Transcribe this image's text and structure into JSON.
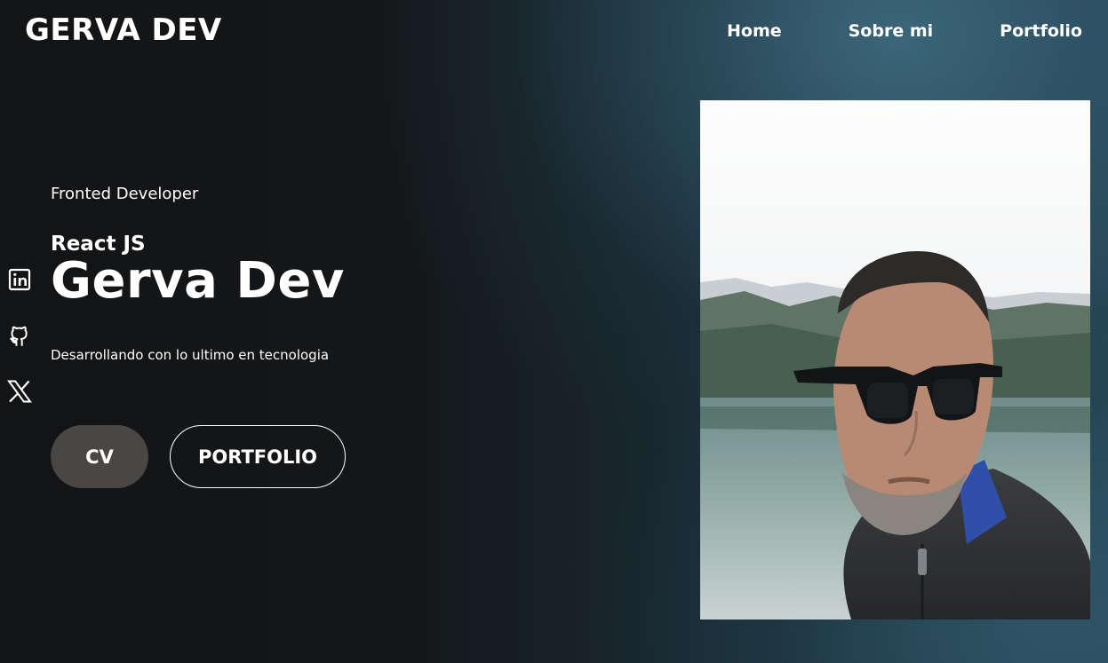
{
  "header": {
    "brand": "GERVA DEV",
    "nav": [
      {
        "label": "Home"
      },
      {
        "label": "Sobre mi"
      },
      {
        "label": "Portfolio"
      }
    ]
  },
  "social": [
    {
      "icon": "linkedin-icon"
    },
    {
      "icon": "github-icon"
    },
    {
      "icon": "x-icon"
    }
  ],
  "hero": {
    "subtitle": "Fronted Developer",
    "tech": "React JS",
    "name": "Gerva Dev",
    "tagline": "Desarrollando con lo ultimo en tecnologia",
    "buttons": {
      "cv": "CV",
      "portfolio": "PORTFOLIO"
    }
  },
  "colors": {
    "cv_button": "#4a4644",
    "text": "#ffffff",
    "background_dark": "#131416",
    "background_teal": "#2d5466"
  }
}
